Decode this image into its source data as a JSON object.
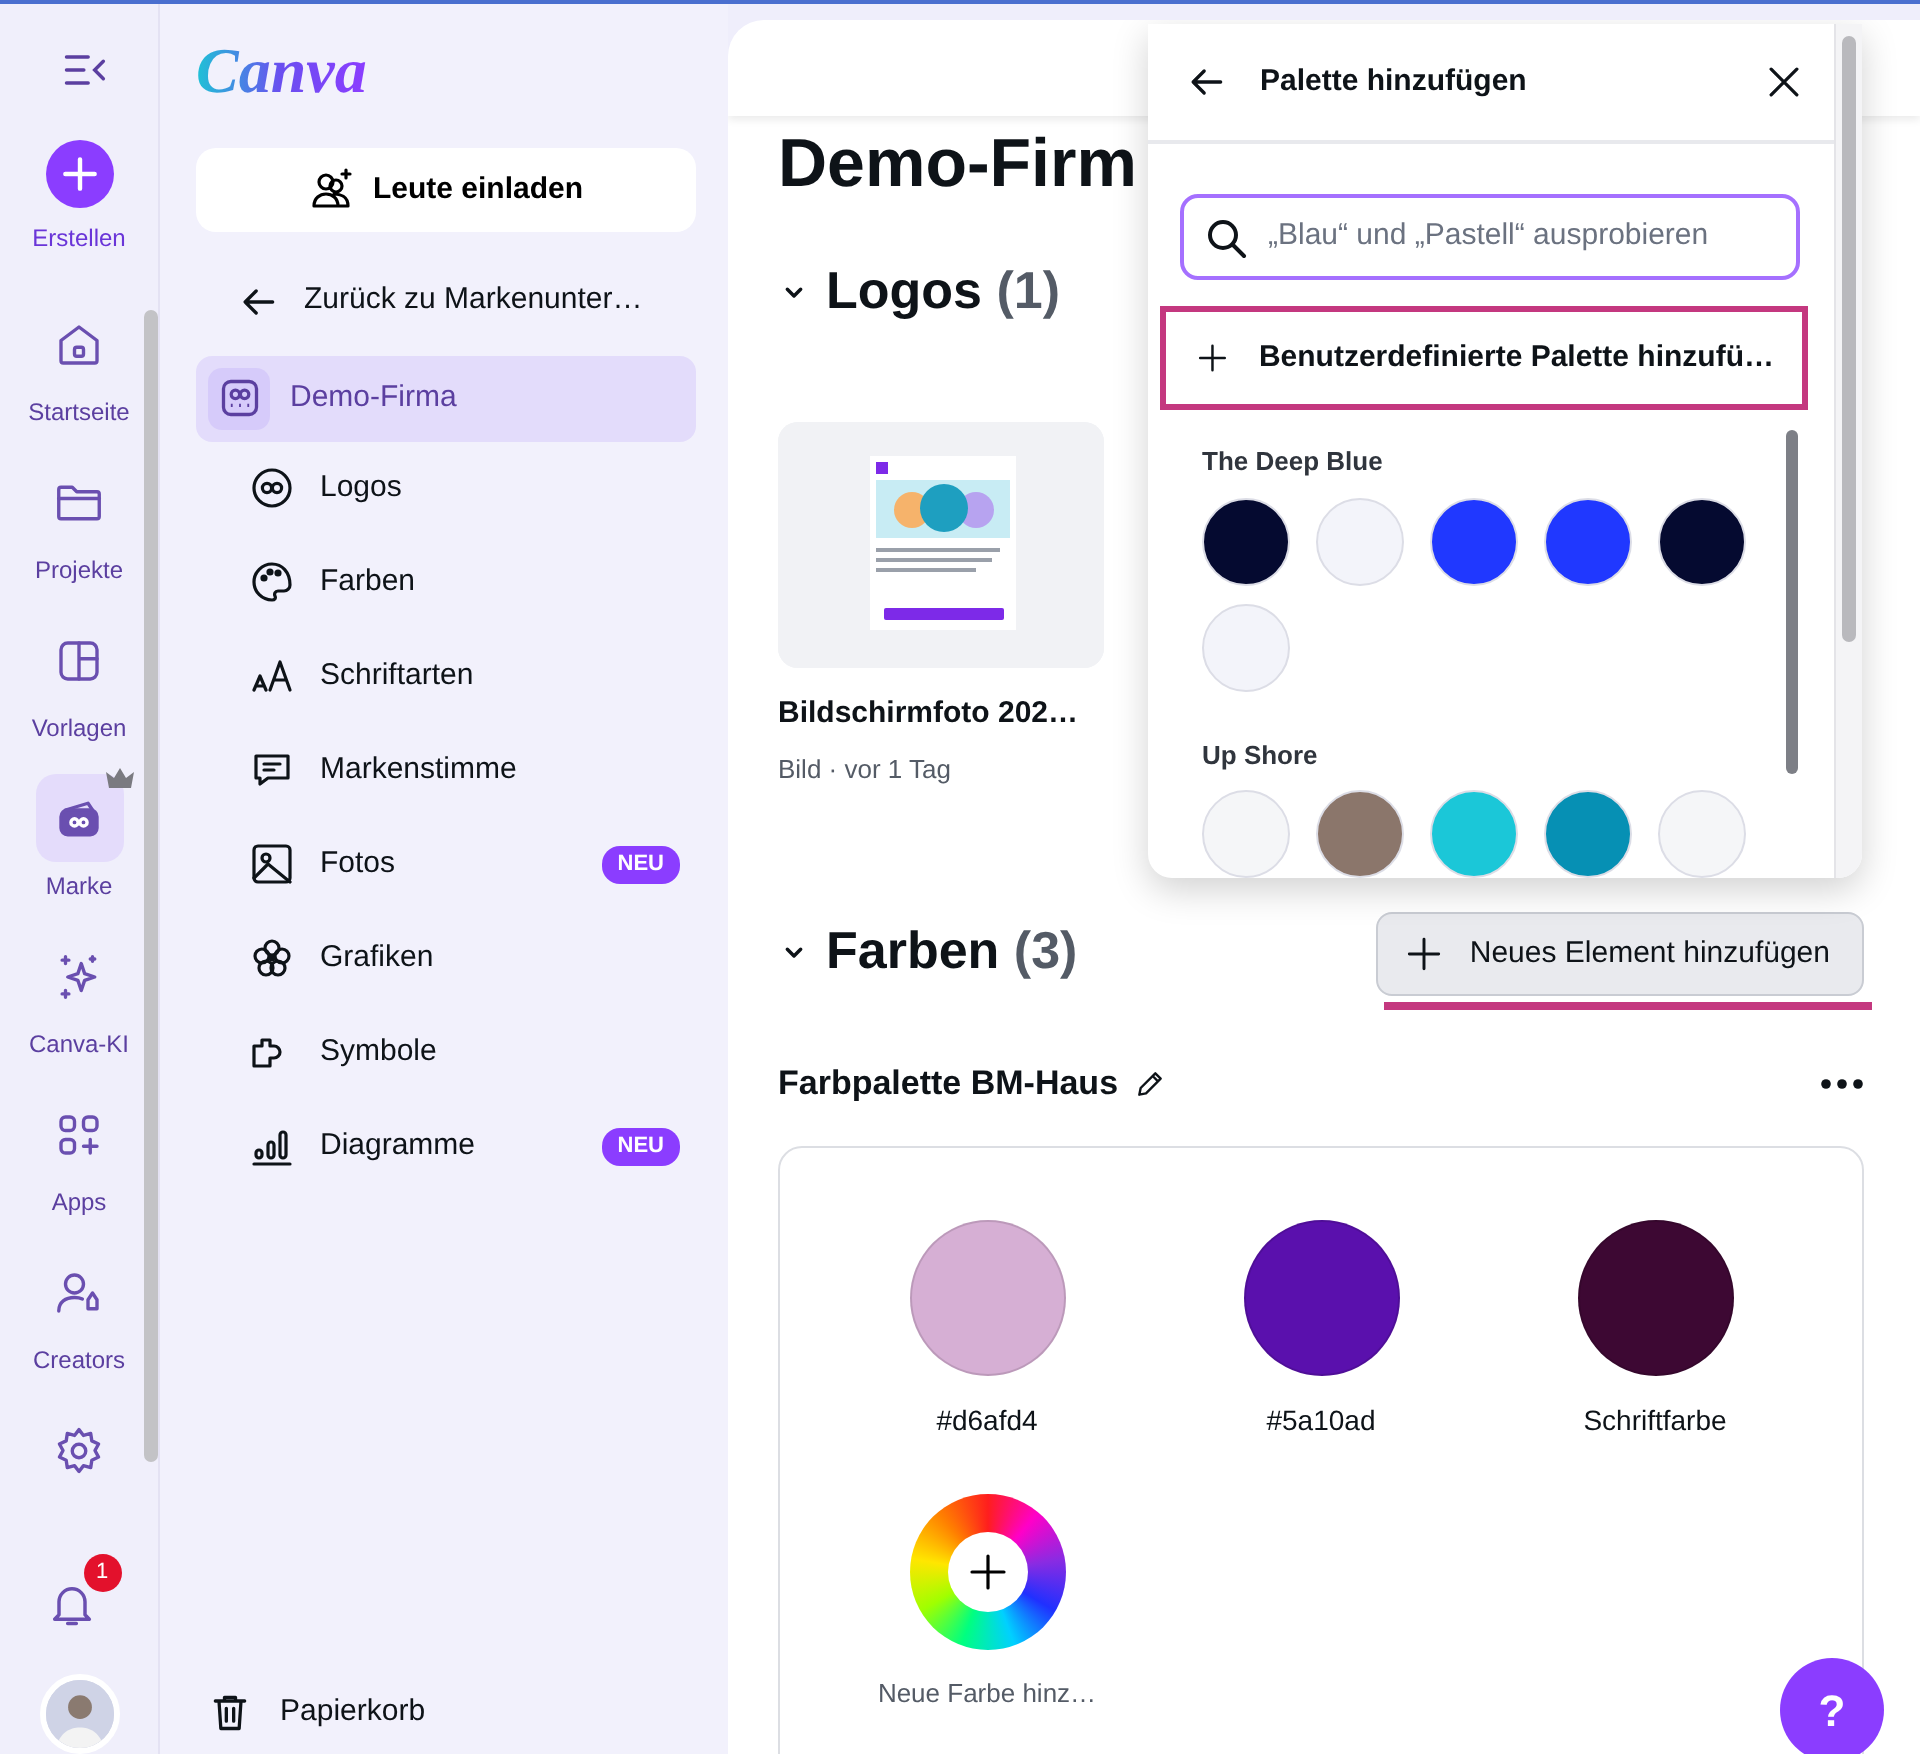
{
  "rail": {
    "create": {
      "label": "Erstellen"
    },
    "items": [
      {
        "kind": "home",
        "label": "Startseite",
        "selected": false,
        "premium": false
      },
      {
        "kind": "projects",
        "label": "Projekte",
        "selected": false,
        "premium": false
      },
      {
        "kind": "templates",
        "label": "Vorlagen",
        "selected": false,
        "premium": false
      },
      {
        "kind": "brand",
        "label": "Marke",
        "selected": true,
        "premium": true
      },
      {
        "kind": "ai",
        "label": "Canva-KI",
        "selected": false,
        "premium": false
      },
      {
        "kind": "apps",
        "label": "Apps",
        "selected": false,
        "premium": false
      },
      {
        "kind": "creators",
        "label": "Creators",
        "selected": false,
        "premium": false
      },
      {
        "kind": "settings",
        "selected": false,
        "premium": false
      }
    ],
    "notifications": {
      "count": "1"
    }
  },
  "sidebar": {
    "logo": "Canva",
    "invite_button": "Leute einladen",
    "back_link": "Zurück zu Markenunter…",
    "brand": {
      "label": "Demo-Firma",
      "selected": true
    },
    "items": [
      {
        "kind": "logos",
        "label": "Logos"
      },
      {
        "kind": "colors",
        "label": "Farben"
      },
      {
        "kind": "fonts",
        "label": "Schriftarten"
      },
      {
        "kind": "voice",
        "label": "Markenstimme"
      },
      {
        "kind": "photos",
        "label": "Fotos",
        "badge": "NEU"
      },
      {
        "kind": "graphics",
        "label": "Grafiken"
      },
      {
        "kind": "icons",
        "label": "Symbole"
      },
      {
        "kind": "charts",
        "label": "Diagramme",
        "badge": "NEU"
      }
    ],
    "trash": "Papierkorb"
  },
  "main": {
    "title": "Demo-Firm",
    "logos": {
      "title": "Logos",
      "count": "(1)",
      "expanded": true,
      "items": [
        {
          "kind": "picture",
          "name": "Bildschirmfoto 202…",
          "meta": "Bild · vor 1 Tag"
        }
      ]
    },
    "colors": {
      "title": "Farben",
      "count": "(3)",
      "expanded": true,
      "add_button": {
        "label": "Neues Element hinzufügen",
        "highlighted": true
      },
      "palettes": [
        {
          "name": "Farbpalette BM-Haus",
          "colors": [
            {
              "label": "#d6afd4",
              "color": "#d6afd4"
            },
            {
              "label": "#5a10ad",
              "color": "#5a10ad"
            },
            {
              "label": "Schriftfarbe",
              "color": "#3d0833"
            }
          ],
          "add_color": "Neue Farbe hinz…"
        }
      ]
    },
    "help_button": "?"
  },
  "popover": {
    "title": "Palette hinzufügen",
    "search": {
      "placeholder": "„Blau“ und „Pastell“ ausprobieren"
    },
    "custom_button": {
      "label": "Benutzerdefinierte Palette hinzufü…",
      "highlighted": true
    },
    "palettes": [
      {
        "name": "The Deep Blue",
        "colors": [
          {
            "color": "#050a30"
          },
          {
            "color": "#f3f4fa"
          },
          {
            "color": "#2038ff"
          },
          {
            "color": "#2038ff"
          },
          {
            "color": "#050a30"
          },
          {
            "color": "#f3f4fa"
          }
        ]
      },
      {
        "name": "Up Shore",
        "colors": [
          {
            "color": "#f5f6f8"
          },
          {
            "color": "#8b766b"
          },
          {
            "color": "#1bc7d8"
          },
          {
            "color": "#0690b4"
          },
          {
            "color": "#f5f6f8"
          }
        ]
      }
    ]
  }
}
